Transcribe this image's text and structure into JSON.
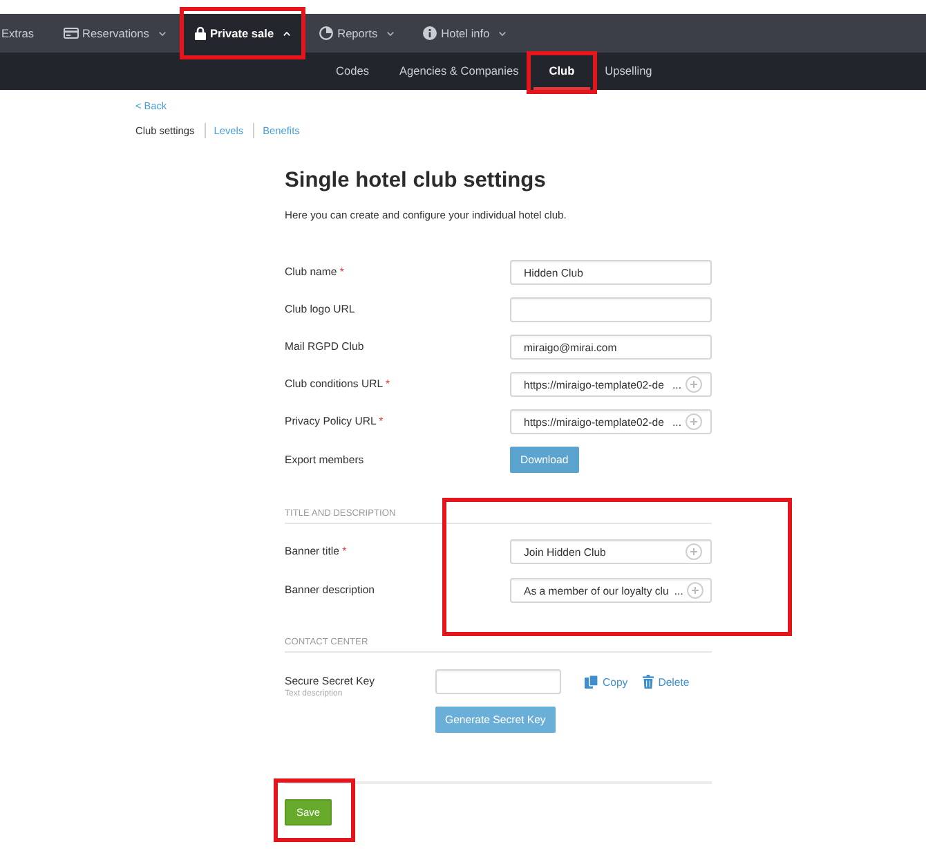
{
  "top_nav": [
    {
      "label": "Extras",
      "selected": false,
      "highlighted": false
    },
    {
      "label": "Reservations",
      "selected": false,
      "expanded": false,
      "highlighted": false
    },
    {
      "label": "Private sale",
      "selected": true,
      "expanded": true,
      "highlighted": true
    },
    {
      "label": "Reports",
      "selected": false,
      "expanded": false,
      "highlighted": false
    },
    {
      "label": "Hotel info",
      "selected": false,
      "expanded": false,
      "highlighted": false
    }
  ],
  "sub_nav": [
    {
      "label": "Codes",
      "selected": false,
      "highlighted": false
    },
    {
      "label": "Agencies & Companies",
      "selected": false,
      "highlighted": false
    },
    {
      "label": "Club",
      "selected": true,
      "highlighted": true
    },
    {
      "label": "Upselling",
      "selected": false,
      "highlighted": false
    }
  ],
  "back_link": "< Back",
  "page_tabs": [
    {
      "label": "Club settings",
      "selected": true
    },
    {
      "label": "Levels",
      "selected": false
    },
    {
      "label": "Benefits",
      "selected": false
    }
  ],
  "title": "Single hotel club settings",
  "description": "Here you can create and configure your individual hotel club.",
  "general_fields": [
    {
      "kind": "text",
      "label": "Club name",
      "required_mark": "*",
      "value": "Hidden Club"
    },
    {
      "kind": "text",
      "label": "Club logo URL"
    },
    {
      "kind": "text",
      "label": "Mail RGPD Club",
      "value": "miraigo@mirai.com"
    },
    {
      "kind": "translatable",
      "label": "Club conditions URL",
      "required_mark": "*",
      "value": "https://miraigo-template02-de",
      "overflow": "..."
    },
    {
      "kind": "translatable",
      "label": "Privacy Policy URL",
      "required_mark": "*",
      "value": "https://miraigo-template02-de",
      "overflow": "..."
    },
    {
      "kind": "button",
      "label": "Export members",
      "button": "Download"
    }
  ],
  "sections": [
    {
      "heading": "TITLE AND DESCRIPTION",
      "highlighted": true,
      "fields": [
        {
          "kind": "translatable",
          "label": "Banner title",
          "required_mark": "*",
          "value": "Join Hidden Club"
        },
        {
          "kind": "translatable",
          "label": "Banner description",
          "value": "As a member of our loyalty clu",
          "overflow": "..."
        }
      ]
    },
    {
      "heading": "CONTACT CENTER",
      "highlighted": false,
      "fields": [
        {
          "kind": "secret_key",
          "label": "Secure Secret Key",
          "hint": "Text description",
          "actions": [
            "Copy",
            "Delete"
          ],
          "button": "Generate Secret Key"
        }
      ]
    }
  ],
  "save": {
    "label": "Save",
    "highlighted": true
  }
}
